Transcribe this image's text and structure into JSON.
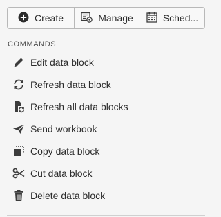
{
  "toolbar": {
    "create": {
      "label": "Create",
      "icon": "plus-circle-icon"
    },
    "manage": {
      "label": "Manage",
      "icon": "manage-settings-icon"
    },
    "schedule": {
      "label": "Sched...",
      "icon": "calendar-icon"
    }
  },
  "commands_heading": "COMMANDS",
  "commands": [
    {
      "label": "Edit data block",
      "icon": "pencil-icon"
    },
    {
      "label": "Refresh data block",
      "icon": "refresh-icon"
    },
    {
      "label": "Refresh all data blocks",
      "icon": "refresh-all-icon"
    },
    {
      "label": "Send workbook",
      "icon": "send-icon"
    },
    {
      "label": "Copy data block",
      "icon": "copy-icon"
    },
    {
      "label": "Cut data block",
      "icon": "scissors-icon"
    },
    {
      "label": "Delete data block",
      "icon": "trash-icon"
    }
  ],
  "colors": {
    "background": "#f5f5f5",
    "text": "#2c2c2c",
    "icon": "#3c3c3c",
    "border": "#b8b8b8"
  }
}
